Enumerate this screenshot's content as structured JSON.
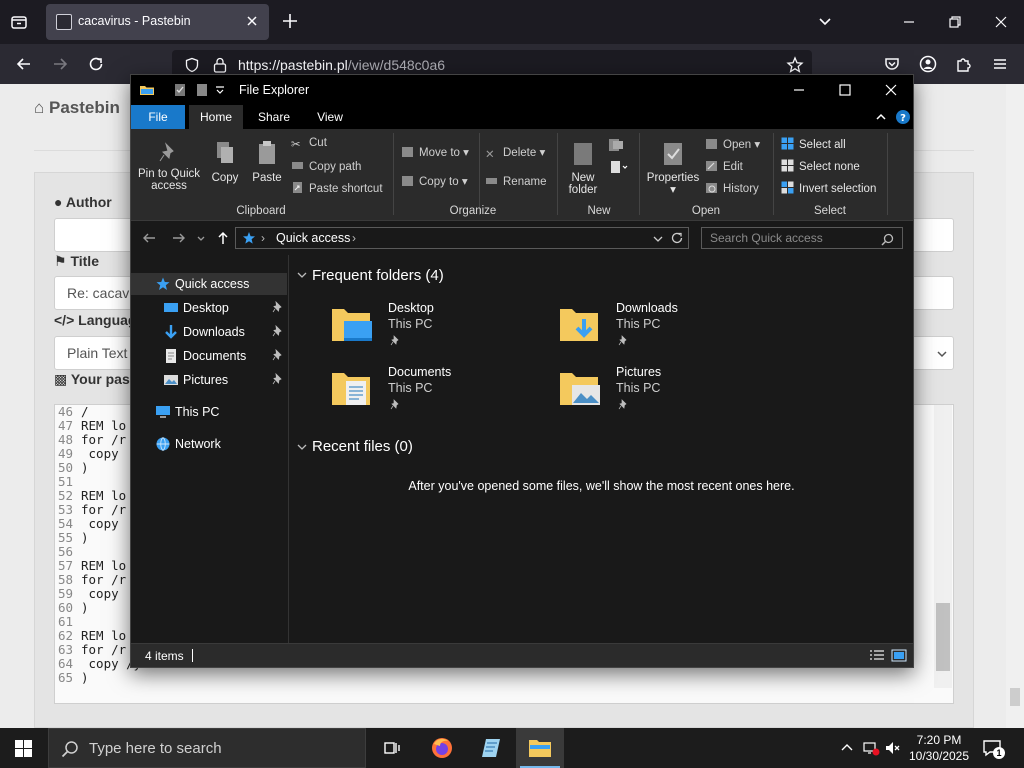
{
  "browser": {
    "tab_title": "cacavirus - Pastebin",
    "url_host": "https://pastebin.pl",
    "url_path": "/view/d548c0a6"
  },
  "pastebin": {
    "brand": "Pastebin",
    "author_label": "Author",
    "title_label": "Title",
    "title_value": "Re: cacavi",
    "language_label": "Languag",
    "language_value": "Plain Text",
    "paste_label": "Your pas",
    "code_lines": [
      {
        "n": "46",
        "t": "/"
      },
      {
        "n": "47",
        "t": "REM lo"
      },
      {
        "n": "48",
        "t": "for /r"
      },
      {
        "n": "49",
        "t": " copy"
      },
      {
        "n": "50",
        "t": ")"
      },
      {
        "n": "51",
        "t": ""
      },
      {
        "n": "52",
        "t": "REM lo"
      },
      {
        "n": "53",
        "t": "for /r"
      },
      {
        "n": "54",
        "t": " copy"
      },
      {
        "n": "55",
        "t": ")"
      },
      {
        "n": "56",
        "t": ""
      },
      {
        "n": "57",
        "t": "REM lo"
      },
      {
        "n": "58",
        "t": "for /r"
      },
      {
        "n": "59",
        "t": " copy"
      },
      {
        "n": "60",
        "t": ")"
      },
      {
        "n": "61",
        "t": ""
      },
      {
        "n": "62",
        "t": "REM lo"
      },
      {
        "n": "63",
        "t": "for /r"
      },
      {
        "n": "64",
        "t": " copy /y"
      },
      {
        "n": "65",
        "t": ")"
      }
    ]
  },
  "explorer": {
    "title": "File Explorer",
    "ribbon_tabs": [
      "File",
      "Home",
      "Share",
      "View"
    ],
    "clipboard": {
      "pin_line1": "Pin to Quick",
      "pin_line2": "access",
      "copy": "Copy",
      "paste": "Paste",
      "cut": "Cut",
      "copy_path": "Copy path",
      "paste_shortcut": "Paste shortcut",
      "group": "Clipboard"
    },
    "organize": {
      "move_to": "Move to",
      "copy_to": "Copy to",
      "delete": "Delete",
      "rename": "Rename",
      "group": "Organize"
    },
    "new": {
      "new_folder_line1": "New",
      "new_folder_line2": "folder",
      "group": "New"
    },
    "open": {
      "properties": "Properties",
      "open": "Open",
      "edit": "Edit",
      "history": "History",
      "group": "Open"
    },
    "select": {
      "select_all": "Select all",
      "select_none": "Select none",
      "invert": "Invert selection",
      "group": "Select"
    },
    "address": {
      "crumb": "Quick access",
      "search_placeholder": "Search Quick access"
    },
    "nav": {
      "quick_access": "Quick access",
      "pinned": [
        "Desktop",
        "Downloads",
        "Documents",
        "Pictures"
      ],
      "this_pc": "This PC",
      "network": "Network"
    },
    "frequent_header": "Frequent folders (4)",
    "folders": [
      {
        "name": "Desktop",
        "location": "This PC"
      },
      {
        "name": "Downloads",
        "location": "This PC"
      },
      {
        "name": "Documents",
        "location": "This PC"
      },
      {
        "name": "Pictures",
        "location": "This PC"
      }
    ],
    "recent_header": "Recent files (0)",
    "recent_empty": "After you've opened some files, we'll show the most recent ones here.",
    "status_items": "4 items"
  },
  "taskbar": {
    "search_placeholder": "Type here to search",
    "time": "7:20 PM",
    "date": "10/30/2025",
    "notification_count": "1"
  },
  "colors": {
    "file_tab": "#1979ca",
    "explorer_bg": "#191919",
    "ribbon_bg": "#2b2b2b",
    "accent_blue": "#3aa0f3",
    "folder_yellow": "#f4c95d"
  }
}
